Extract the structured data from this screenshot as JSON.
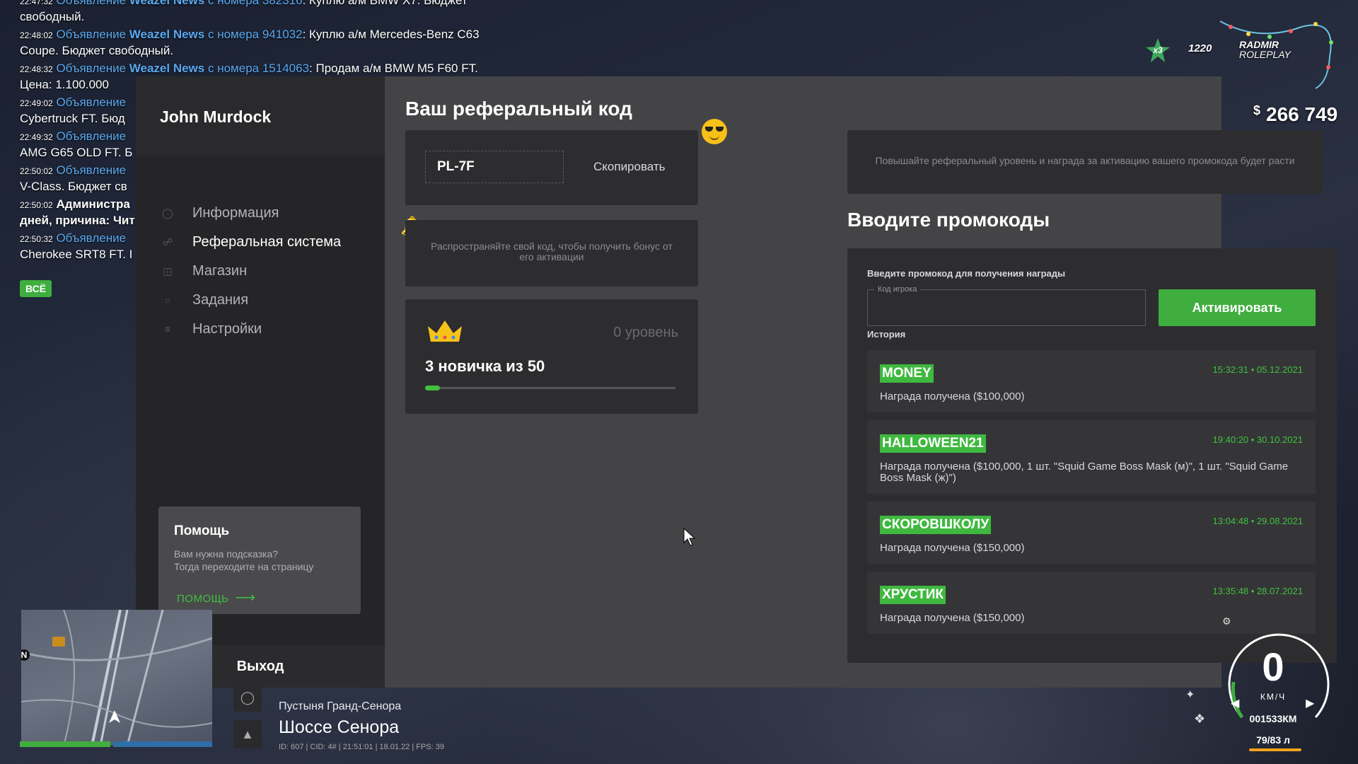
{
  "chat": {
    "messages": [
      {
        "time": "22:47:32",
        "tag": "Объявление",
        "src": "Weazel News",
        "mid": "с номера",
        "num": "382316",
        "text": "Куплю а/м BMW X7. Бюджет свободный."
      },
      {
        "time": "22:48:02",
        "tag": "Объявление",
        "src": "Weazel News",
        "mid": "с номера",
        "num": "941032",
        "text": "Куплю а/м Mercedes-Benz C63 Coupe. Бюджет свободный."
      },
      {
        "time": "22:48:32",
        "tag": "Объявление",
        "src": "Weazel News",
        "mid": "с номера",
        "num": "1514063",
        "text": "Продам а/м BMW M5 F60 FT. Цена: 1.100.000"
      },
      {
        "time": "22:49:02",
        "tag": "Объявление",
        "src": "",
        "mid": "",
        "num": "",
        "text": "Cybertruck FT. Бюд"
      },
      {
        "time": "22:49:32",
        "tag": "Объявление",
        "src": "",
        "mid": "",
        "num": "",
        "text": "AMG G65 OLD FT. Б"
      },
      {
        "time": "22:50:02",
        "tag": "Объявление",
        "src": "",
        "mid": "",
        "num": "",
        "text": "V-Class. Бюджет св"
      },
      {
        "time": "22:50:02",
        "tag": "Администра",
        "src": "",
        "mid": "",
        "num": "",
        "text": "дней, причина: Чит"
      },
      {
        "time": "22:50:32",
        "tag": "Объявление",
        "src": "",
        "mid": "",
        "num": "",
        "text": "Cherokee SRT8 FT. I"
      }
    ],
    "tab_label": "ВСЁ"
  },
  "sidebar": {
    "user_name": "John Murdock",
    "items": [
      {
        "label": "Информация",
        "icon": "user-icon"
      },
      {
        "label": "Реферальная система",
        "icon": "link-icon"
      },
      {
        "label": "Магазин",
        "icon": "cart-icon"
      },
      {
        "label": "Задания",
        "icon": "tasks-icon"
      },
      {
        "label": "Настройки",
        "icon": "settings-icon"
      }
    ],
    "active_index": 1,
    "help": {
      "title": "Помощь",
      "text_line1": "Вам нужна подсказка?",
      "text_line2": "Тогда переходите на страницу",
      "link": "ПОМОЩЬ"
    },
    "logout": "Выход"
  },
  "referral": {
    "title": "Ваш реферальный код",
    "code": "PL-7F",
    "copy_label": "Скопировать",
    "hint_share": "Распространяйте свой код, чтобы получить бонус от его активации",
    "hint_level": "Повышайте реферальный уровень и награда за активацию вашего промокода будет расти",
    "level_label": "0 уровень",
    "progress_text": "3 новичка из 50",
    "progress_fraction": 0.06
  },
  "promo": {
    "title": "Вводите промокоды",
    "prompt": "Введите промокод для получения награды",
    "input_label": "Код игрока",
    "input_value": "",
    "activate_label": "Активировать",
    "history_label": "История",
    "history": [
      {
        "code": "MONEY",
        "date": "15:32:31 • 05.12.2021",
        "desc": "Награда получена ($100,000)"
      },
      {
        "code": "HALLOWEEN21",
        "date": "19:40:20 • 30.10.2021",
        "desc": "Награда получена ($100,000, 1 шт. \"Squid Game Boss Mask (м)\", 1 шт. \"Squid Game Boss Mask (ж)\")"
      },
      {
        "code": "СКОРОВШКОЛУ",
        "date": "13:04:48 • 29.08.2021",
        "desc": "Награда получена ($150,000)"
      },
      {
        "code": "ХРУСТИК",
        "date": "13:35:48 • 28.07.2021",
        "desc": "Награда получена ($150,000)"
      }
    ]
  },
  "hud": {
    "multiplier": "x3",
    "online": "1220",
    "logo_line1": "RADMIR",
    "logo_line2": "ROLEPLAY",
    "money_sign": "$",
    "money": "266 749",
    "compass": "N",
    "zone": "Пустыня Гранд-Сенора",
    "street": "Шоссе Сенора",
    "session": "ID: 607 | CID: 4# | 21:51:01 | 18.01.22 | FPS: 39",
    "speed": "0",
    "speed_unit": "КМ/Ч",
    "odometer": "001533КМ",
    "fuel": "79/83 л"
  },
  "colors": {
    "accent": "#3fae3f",
    "link": "#5aa9f0",
    "panel": "#444446",
    "sidebar": "#252527",
    "card": "#2d2d2f"
  }
}
